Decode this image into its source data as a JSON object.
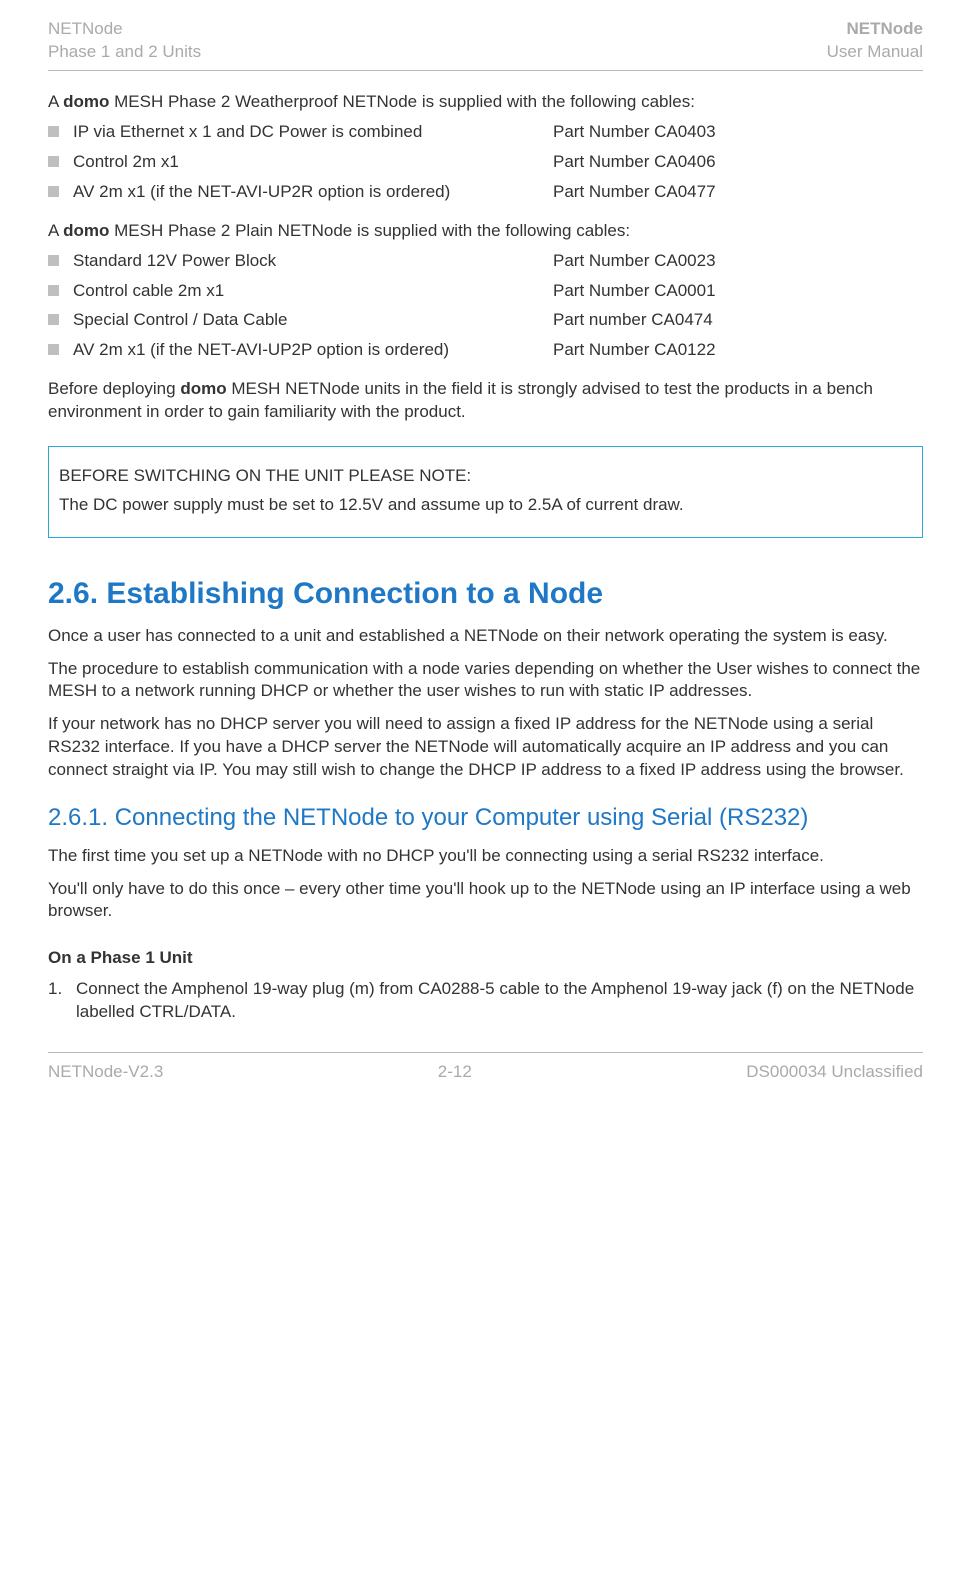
{
  "header": {
    "left_line1": "NETNode",
    "left_line2": "Phase 1 and 2 Units",
    "right_line1": "NETNode",
    "right_line2": "User Manual"
  },
  "section_a": {
    "intro_pre": "A ",
    "intro_bold": "domo",
    "intro_post": " MESH Phase 2 Weatherproof NETNode is supplied with the following cables:",
    "items": [
      {
        "desc": "IP via Ethernet x 1 and DC Power is combined",
        "part": "Part Number CA0403"
      },
      {
        "desc": "Control 2m x1",
        "part": "Part Number CA0406"
      },
      {
        "desc": "AV 2m x1 (if the NET-AVI-UP2R option is ordered)",
        "part": "Part Number CA0477"
      }
    ]
  },
  "section_b": {
    "intro_pre": "A ",
    "intro_bold": "domo",
    "intro_post": " MESH Phase 2 Plain NETNode is supplied with the following cables:",
    "items": [
      {
        "desc": "Standard 12V Power Block",
        "part": "Part Number CA0023"
      },
      {
        "desc": "Control cable 2m x1",
        "part": "Part Number CA0001"
      },
      {
        "desc": "Special Control / Data Cable",
        "part": "Part number CA0474"
      },
      {
        "desc": "AV 2m x1 (if the NET-AVI-UP2P option is ordered)",
        "part": "Part Number CA0122"
      }
    ]
  },
  "advice": {
    "pre": "Before deploying ",
    "bold": "domo",
    "post": " MESH NETNode units in the field it is strongly advised to test the products in a bench environment in order to gain familiarity with the product."
  },
  "notebox": {
    "line1": "BEFORE SWITCHING ON THE UNIT PLEASE NOTE:",
    "line2": "The DC power supply must be set to 12.5V and assume up to 2.5A of current draw."
  },
  "sec26": {
    "title": "2.6.   Establishing Connection to a Node",
    "p1": "Once a user has connected to a unit and established a NETNode on their network operating the system is easy.",
    "p2": "The procedure to establish communication with a node varies depending on whether the User wishes to connect the MESH to a network running DHCP or whether the user wishes to run with static IP addresses.",
    "p3": "If your network has no DHCP server you will need to assign a fixed IP address for the NETNode using a serial RS232 interface. If you have a DHCP server the NETNode will automatically acquire an IP address and you can connect straight via IP. You may still wish to change the DHCP IP address to a fixed IP address using the browser."
  },
  "sec261": {
    "title": "2.6.1.  Connecting the NETNode to your Computer using Serial (RS232)",
    "p1": "The first time you set up a NETNode with no DHCP you'll be connecting using a serial RS232 interface.",
    "p2": "You'll only have to do this once – every other time you'll hook up to the NETNode using an IP interface using a web browser."
  },
  "phase1": {
    "heading": "On a Phase 1 Unit",
    "step1_num": "1.",
    "step1_text": "Connect the Amphenol 19-way plug (m) from CA0288-5 cable to the Amphenol 19-way jack (f) on the NETNode labelled CTRL/DATA."
  },
  "footer": {
    "left": "NETNode-V2.3",
    "center": "2-12",
    "right": "DS000034 Unclassified"
  }
}
